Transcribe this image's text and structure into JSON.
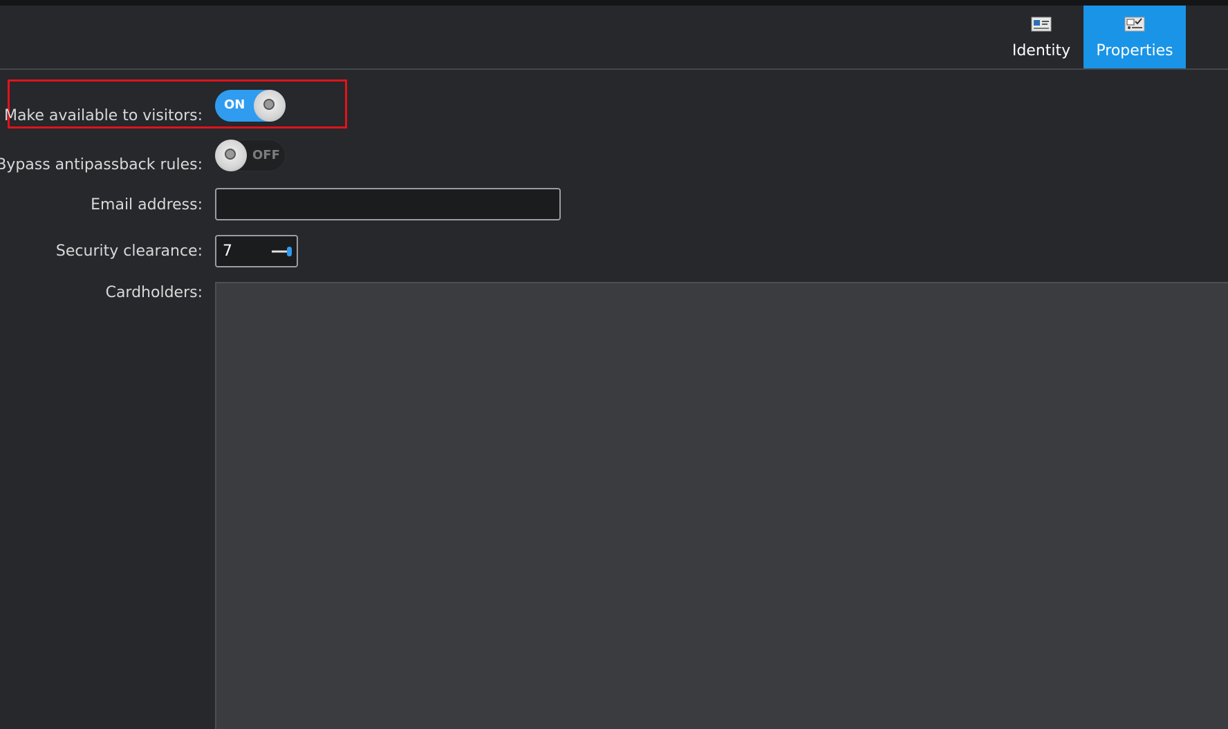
{
  "tabs": [
    {
      "label": "Identity",
      "icon": "identity-card-icon",
      "active": false
    },
    {
      "label": "Properties",
      "icon": "properties-icon",
      "active": true
    }
  ],
  "form": {
    "visitors": {
      "label": "Make available to visitors:",
      "state": "ON"
    },
    "antipassback": {
      "label": "Bypass antipassback rules:",
      "state": "OFF"
    },
    "email": {
      "label": "Email address:",
      "value": "",
      "placeholder": ""
    },
    "clearance": {
      "label": "Security clearance:",
      "value": "7"
    },
    "cardholders": {
      "label": "Cardholders:",
      "items": []
    }
  },
  "colors": {
    "accent": "#1a94e6",
    "toggle_on": "#2f9cf0",
    "highlight": "#e3121c",
    "background": "#26282b",
    "panel": "#3b3c3f"
  }
}
